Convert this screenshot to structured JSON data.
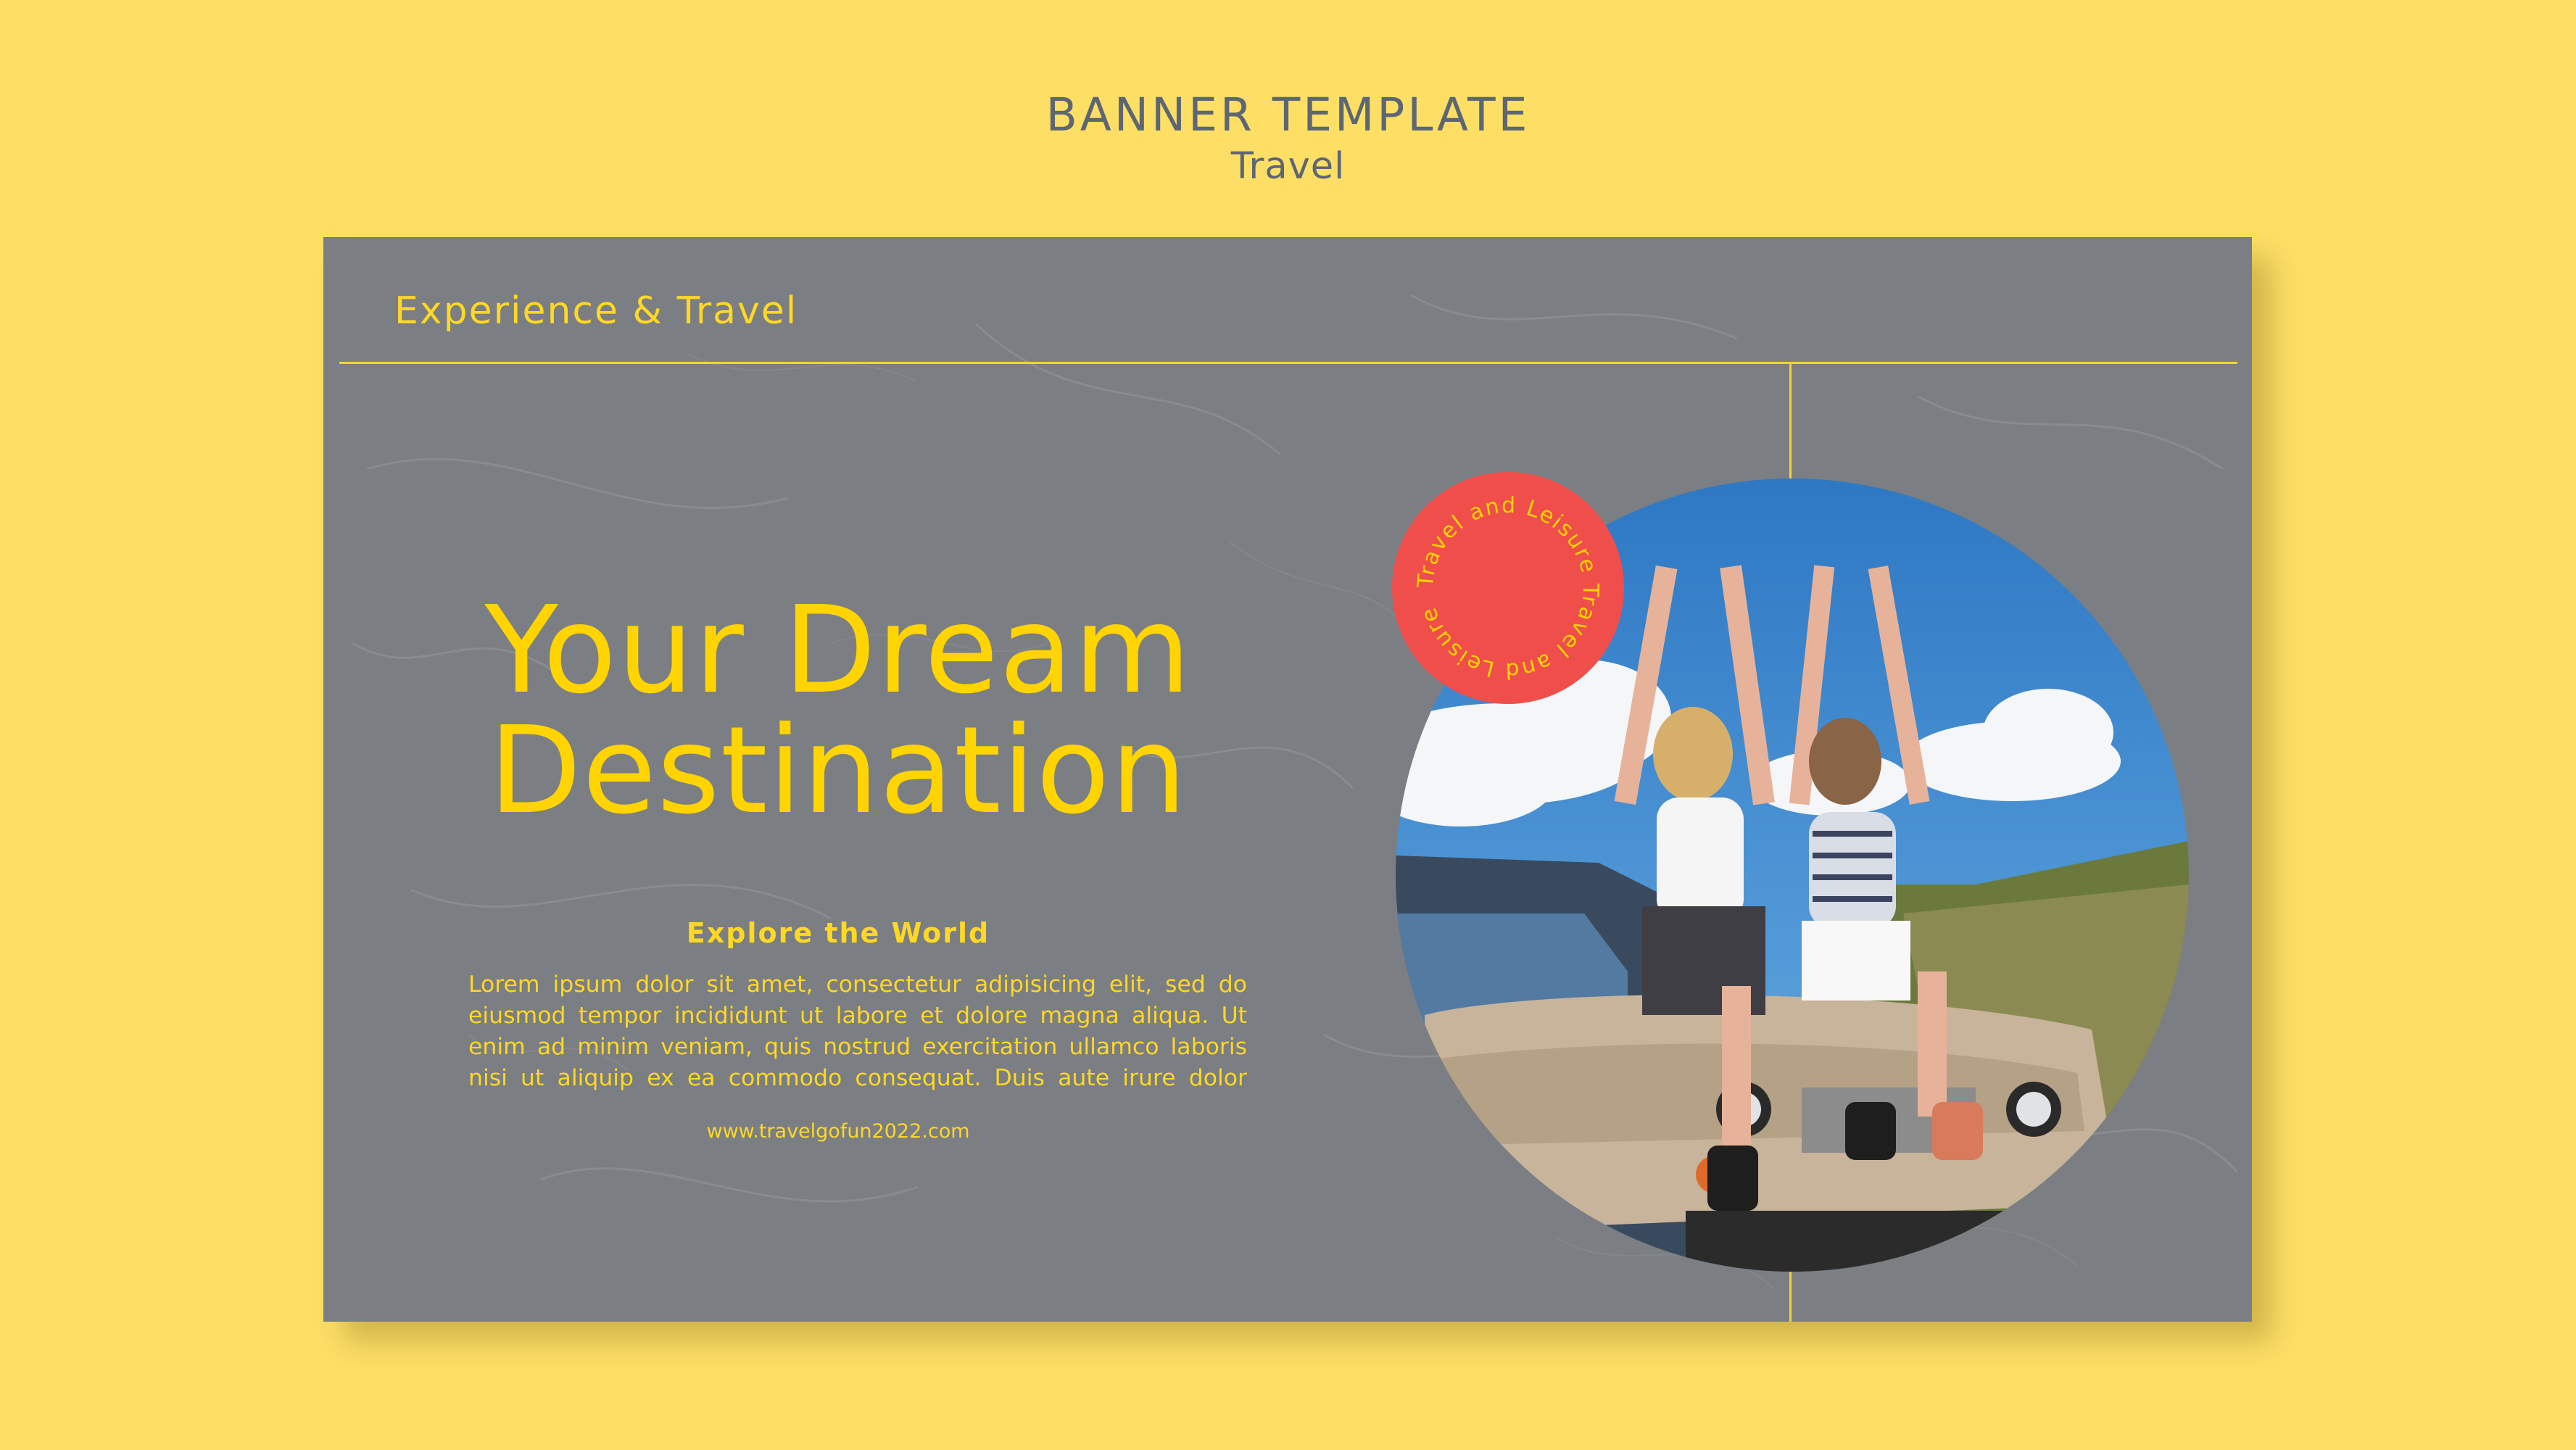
{
  "header": {
    "title": "BANNER TEMPLATE",
    "subtitle": "Travel"
  },
  "banner": {
    "kicker": "Experience & Travel",
    "headline_line1": "Your Dream",
    "headline_line2": "Destination",
    "section_title": "Explore the World",
    "body_line1": "Lorem ipsum dolor sit amet, consectetur adipisicing elit, sed do",
    "body_line2": "eiusmod tempor incididunt ut labore et dolore magna aliqua. Ut",
    "body_line3": "enim ad minim veniam, quis nostrud exercitation ullamco laboris",
    "body_line4": "nisi ut aliquip ex ea commodo consequat. Duis aute irure dolor",
    "url": "www.travelgofun2022.com",
    "badge_text": "Travel and Leisure Travel and Leisure "
  },
  "colors": {
    "background": "#fddf66",
    "banner": "#7b7e82",
    "accent_yellow": "#ffd400",
    "badge_red": "#f04e4a",
    "heading_gray": "#5d6673"
  },
  "icons": {
    "photo": "travel-photo-two-women-on-jeep",
    "badge": "circular-text-badge"
  }
}
